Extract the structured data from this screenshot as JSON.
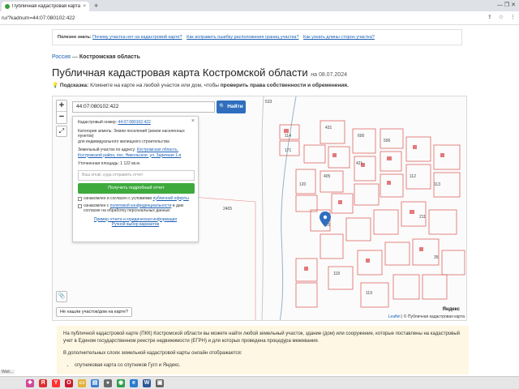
{
  "browser": {
    "tab_title": "Публичная кадастровая карта",
    "tab_close": "×",
    "new_tab": "+",
    "window_controls": "—  ❐  ✕",
    "url": "ru/?kadnum=44:07:080102:422",
    "icons": [
      "share-icon",
      "star-icon",
      "menu-icon"
    ]
  },
  "useful": {
    "label": "Полезно знать:",
    "links": [
      "Почему участка нет на кадастровой карте?",
      "Как исправить ошибку расположения границ участка?",
      "Как узнать длины сторон участка?"
    ]
  },
  "breadcrumb": {
    "root": "Россия",
    "sep": " — ",
    "current": "Костромская область"
  },
  "page": {
    "title": "Публичная кадастровая карта Костромской области",
    "date": "на 08.07.2024"
  },
  "hint": {
    "label": "Подсказка:",
    "text": " Кликните на карте на любой участок или дом, чтобы ",
    "bold": "проверить права собственности и обременения."
  },
  "map": {
    "zoom_in": "+",
    "zoom_out": "−",
    "fullscreen": "⤢",
    "search_value": "44:07:080102:422",
    "find_button": "Найти",
    "clip_icon": "📎",
    "not_found_button": "Не нашли участок/дом на карте?",
    "attribution_leaflet": "Leaflet",
    "attribution_rest": " | © Публичная кадастровая карта",
    "yandex": "Яндекс",
    "parcel_labels": [
      "533",
      "114",
      "171",
      "431",
      "600",
      "120",
      "405",
      "421",
      "500",
      "112",
      "113",
      "118",
      "119",
      "2405",
      "401",
      "211",
      "35"
    ]
  },
  "popup": {
    "close": "×",
    "kadnum_label": "Кадастровый номер: ",
    "kadnum_value": "44:07:080102:422",
    "category_label": "Категория земель: ",
    "category_value": "Земли поселений (земли населенных пунктов)",
    "use_value": "для индивидуального жилищного строительства",
    "address_label": "Земельный участок по адресу: ",
    "address_value": "Костромская область, Костромской район, пос. Никольское, ул. Заречная 1-я",
    "area_label": "Уточненная площадь: ",
    "area_value": "1 122 кв.м.",
    "email_placeholder": "Ваш email, куда отправить отчет",
    "get_report": "Получить подробный отчет",
    "consent1_text": "ознакомлен и согласен с условиями ",
    "consent1_link": "публичной оферты",
    "consent2_text": "ознакомлен с ",
    "consent2_link": "политикой конфиденциальности",
    "consent2_rest": " и даю согласие на обработку персональных данных",
    "report_example": "Пример отчета и юридическая информация",
    "manual_request": "Ручной выбор вариантов"
  },
  "info": {
    "para1": "На публичной кадастровой карте (ПКК) Костромской области вы можете найти любой земельный участок, здание (дом) или сооружение, которые поставлены на кадастровый учет в Едином государственном реестре недвижимости (ЕГРН) и для которых проведена процедура межевания.",
    "para2": "В дополнительных слоях земельной кадастровой карты онлайн отображается:",
    "bullet1": "спутниковая карта со спутников Гугл и Яндекс."
  },
  "status": {
    "text": "Wait..."
  },
  "taskbar": {
    "icons": [
      {
        "name": "start-icon",
        "glyph": "❖",
        "color": "#d04a9a"
      },
      {
        "name": "yandex-browser-icon",
        "glyph": "Я",
        "color": "#e03030"
      },
      {
        "name": "yandex-icon",
        "glyph": "Y",
        "color": "#ff3333"
      },
      {
        "name": "opera-icon",
        "glyph": "O",
        "color": "#cc1b2e"
      },
      {
        "name": "explorer-icon",
        "glyph": "▭",
        "color": "#e2b23a"
      },
      {
        "name": "files-icon",
        "glyph": "▤",
        "color": "#3a7fd0"
      },
      {
        "name": "app-icon",
        "glyph": "●",
        "color": "#6a6a6a"
      },
      {
        "name": "chrome-icon",
        "glyph": "◉",
        "color": "#2f9d4a"
      },
      {
        "name": "edge-icon",
        "glyph": "e",
        "color": "#2a7ad0"
      },
      {
        "name": "word-icon",
        "glyph": "W",
        "color": "#2b5797"
      },
      {
        "name": "monitor-icon",
        "glyph": "▣",
        "color": "#666"
      }
    ]
  },
  "colors": {
    "accent": "#2f6ebf",
    "green": "#3eaa3e",
    "parcel_line": "#d9534f",
    "marker": "#2f6ebf",
    "info_bg": "#fdf7e3"
  }
}
